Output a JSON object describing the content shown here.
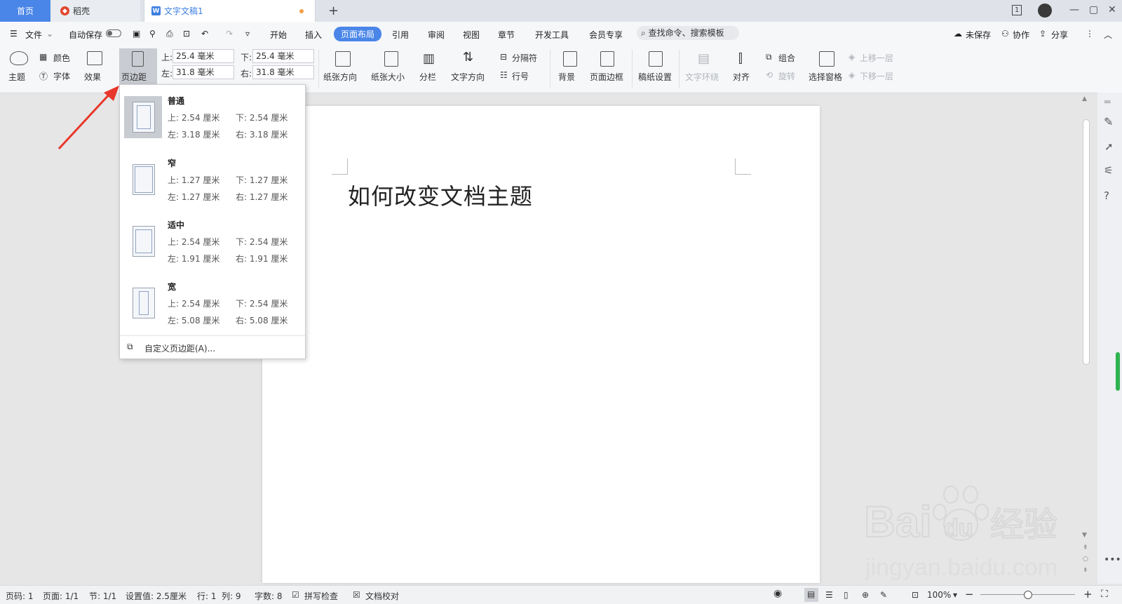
{
  "tabs": {
    "home": "首页",
    "daoke": "稻壳",
    "doc": "文字文稿1",
    "add": "+"
  },
  "window": {
    "badge": "1",
    "min": "—",
    "max": "▢",
    "close": "✕"
  },
  "menu": {
    "file": "文件",
    "autosave": "自动保存",
    "items": [
      "开始",
      "插入",
      "页面布局",
      "引用",
      "审阅",
      "视图",
      "章节",
      "开发工具",
      "会员专享"
    ],
    "search": "查找命令、搜索模板",
    "unsaved": "未保存",
    "collab": "协作",
    "share": "分享"
  },
  "ribbon": {
    "theme": "主题",
    "color": "颜色",
    "font": "字体",
    "effect": "效果",
    "margins": "页边距",
    "top_label": "上:",
    "top_val": "25.4 毫米",
    "bottom_label": "下:",
    "bottom_val": "25.4 毫米",
    "left_label": "左:",
    "left_val": "31.8 毫米",
    "right_label": "右:",
    "right_val": "31.8 毫米",
    "orientation": "纸张方向",
    "size": "纸张大小",
    "columns": "分栏",
    "text_dir": "文字方向",
    "breaks": "分隔符",
    "line_num": "行号",
    "background": "背景",
    "page_border": "页面边框",
    "manuscript": "稿纸设置",
    "wrap": "文字环绕",
    "align": "对齐",
    "group": "组合",
    "rotate": "旋转",
    "selection_pane": "选择窗格",
    "bring_forward": "上移一层",
    "send_backward": "下移一层"
  },
  "document": {
    "title": "如何改变文档主题"
  },
  "margin_menu": {
    "options": [
      {
        "name": "普通",
        "top": "上: 2.54 厘米",
        "bottom": "下: 2.54 厘米",
        "left": "左: 3.18 厘米",
        "right": "右: 3.18 厘米"
      },
      {
        "name": "窄",
        "top": "上: 1.27 厘米",
        "bottom": "下: 1.27 厘米",
        "left": "左: 1.27 厘米",
        "right": "右: 1.27 厘米"
      },
      {
        "name": "适中",
        "top": "上: 2.54 厘米",
        "bottom": "下: 2.54 厘米",
        "left": "左: 1.91 厘米",
        "right": "右: 1.91 厘米"
      },
      {
        "name": "宽",
        "top": "上: 2.54 厘米",
        "bottom": "下: 2.54 厘米",
        "left": "左: 5.08 厘米",
        "right": "右: 5.08 厘米"
      }
    ],
    "custom": "自定义页边距(A)..."
  },
  "status": {
    "page_num": "页码: 1",
    "pages": "页面: 1/1",
    "section": "节: 1/1",
    "setting": "设置值: 2.5厘米",
    "row": "行: 1",
    "col": "列: 9",
    "words": "字数: 8",
    "spell": "拼写检查",
    "proof": "文档校对",
    "zoom": "100%"
  },
  "watermark": {
    "brand": "Bai",
    "brand2": "du",
    "brand_cn": "经验",
    "url": "jingyan.baidu.com"
  },
  "colors": {
    "accent": "#4a86e8",
    "arrow": "#e8372b"
  }
}
